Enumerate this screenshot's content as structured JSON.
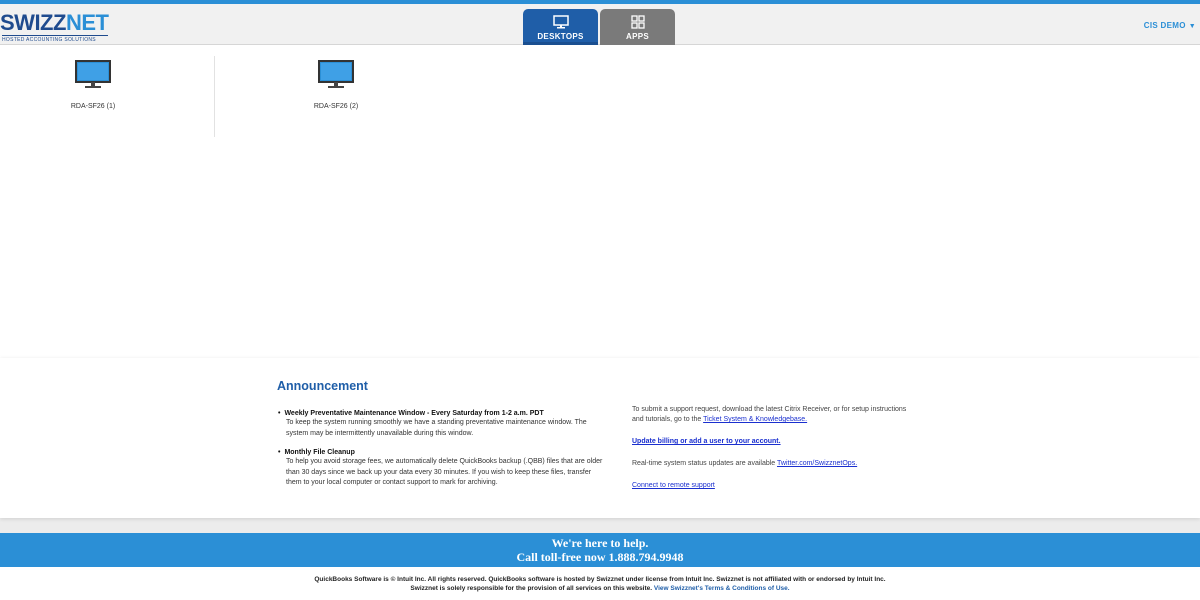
{
  "brand": {
    "name_part1": "SWIZZ",
    "name_part2": "NET",
    "tagline": "Hosted Accounting Solutions"
  },
  "tabs": [
    {
      "label": "DESKTOPS",
      "icon": "monitor-icon",
      "active": true
    },
    {
      "label": "APPS",
      "icon": "grid-icon",
      "active": false
    }
  ],
  "user": {
    "name": "CIS DEMO",
    "caret": "▼"
  },
  "desktops": [
    {
      "label": "RDA-SF26 (1)",
      "icon": "monitor-icon"
    },
    {
      "label": "RDA-SF26 (2)",
      "icon": "monitor-icon"
    }
  ],
  "announcement": {
    "title": "Announcement",
    "items": [
      {
        "bullet": "•",
        "heading": "Weekly Preventative Maintenance Window - Every Saturday from 1-2 a.m. PDT",
        "body": "To keep the system running smoothly we have a standing preventative maintenance window. The system may be intermittently unavailable during this window."
      },
      {
        "bullet": "•",
        "heading": "Monthly File Cleanup",
        "body": "To help you avoid storage fees, we automatically delete QuickBooks backup (.QBB) files that are older than 30 days since we back up your data every 30 minutes. If you wish to keep these files, transfer them to your local computer or contact support to mark for archiving."
      }
    ],
    "support_text": "To submit a support request, download the latest Citrix Receiver, or for setup instructions and tutorials, go to the",
    "support_link": "Ticket System & Knowledgebase.",
    "billing_link": "Update billing or add a user to your account.",
    "status_text": "Real-time system status updates are available",
    "status_link": "Twitter.com/SwizznetOps.",
    "remote_link": "Connect to remote support"
  },
  "help": {
    "line1": "We're here to help.",
    "line2": "Call toll-free now 1.888.794.9948"
  },
  "footer": {
    "line1": "QuickBooks Software is © Intuit Inc. All rights reserved. QuickBooks software is hosted by Swizznet under license from Intuit Inc. Swizznet is not affiliated with or endorsed by Intuit Inc.",
    "line2": "Swizznet is solely responsible for the provision of all services on this website.",
    "terms_link": "View Swizznet's Terms & Conditions of Use."
  },
  "colors": {
    "accent": "#2b8fd6",
    "active_tab": "#1f5ea8",
    "inactive_tab": "#7a7a7a",
    "link": "#1a2fcf"
  }
}
